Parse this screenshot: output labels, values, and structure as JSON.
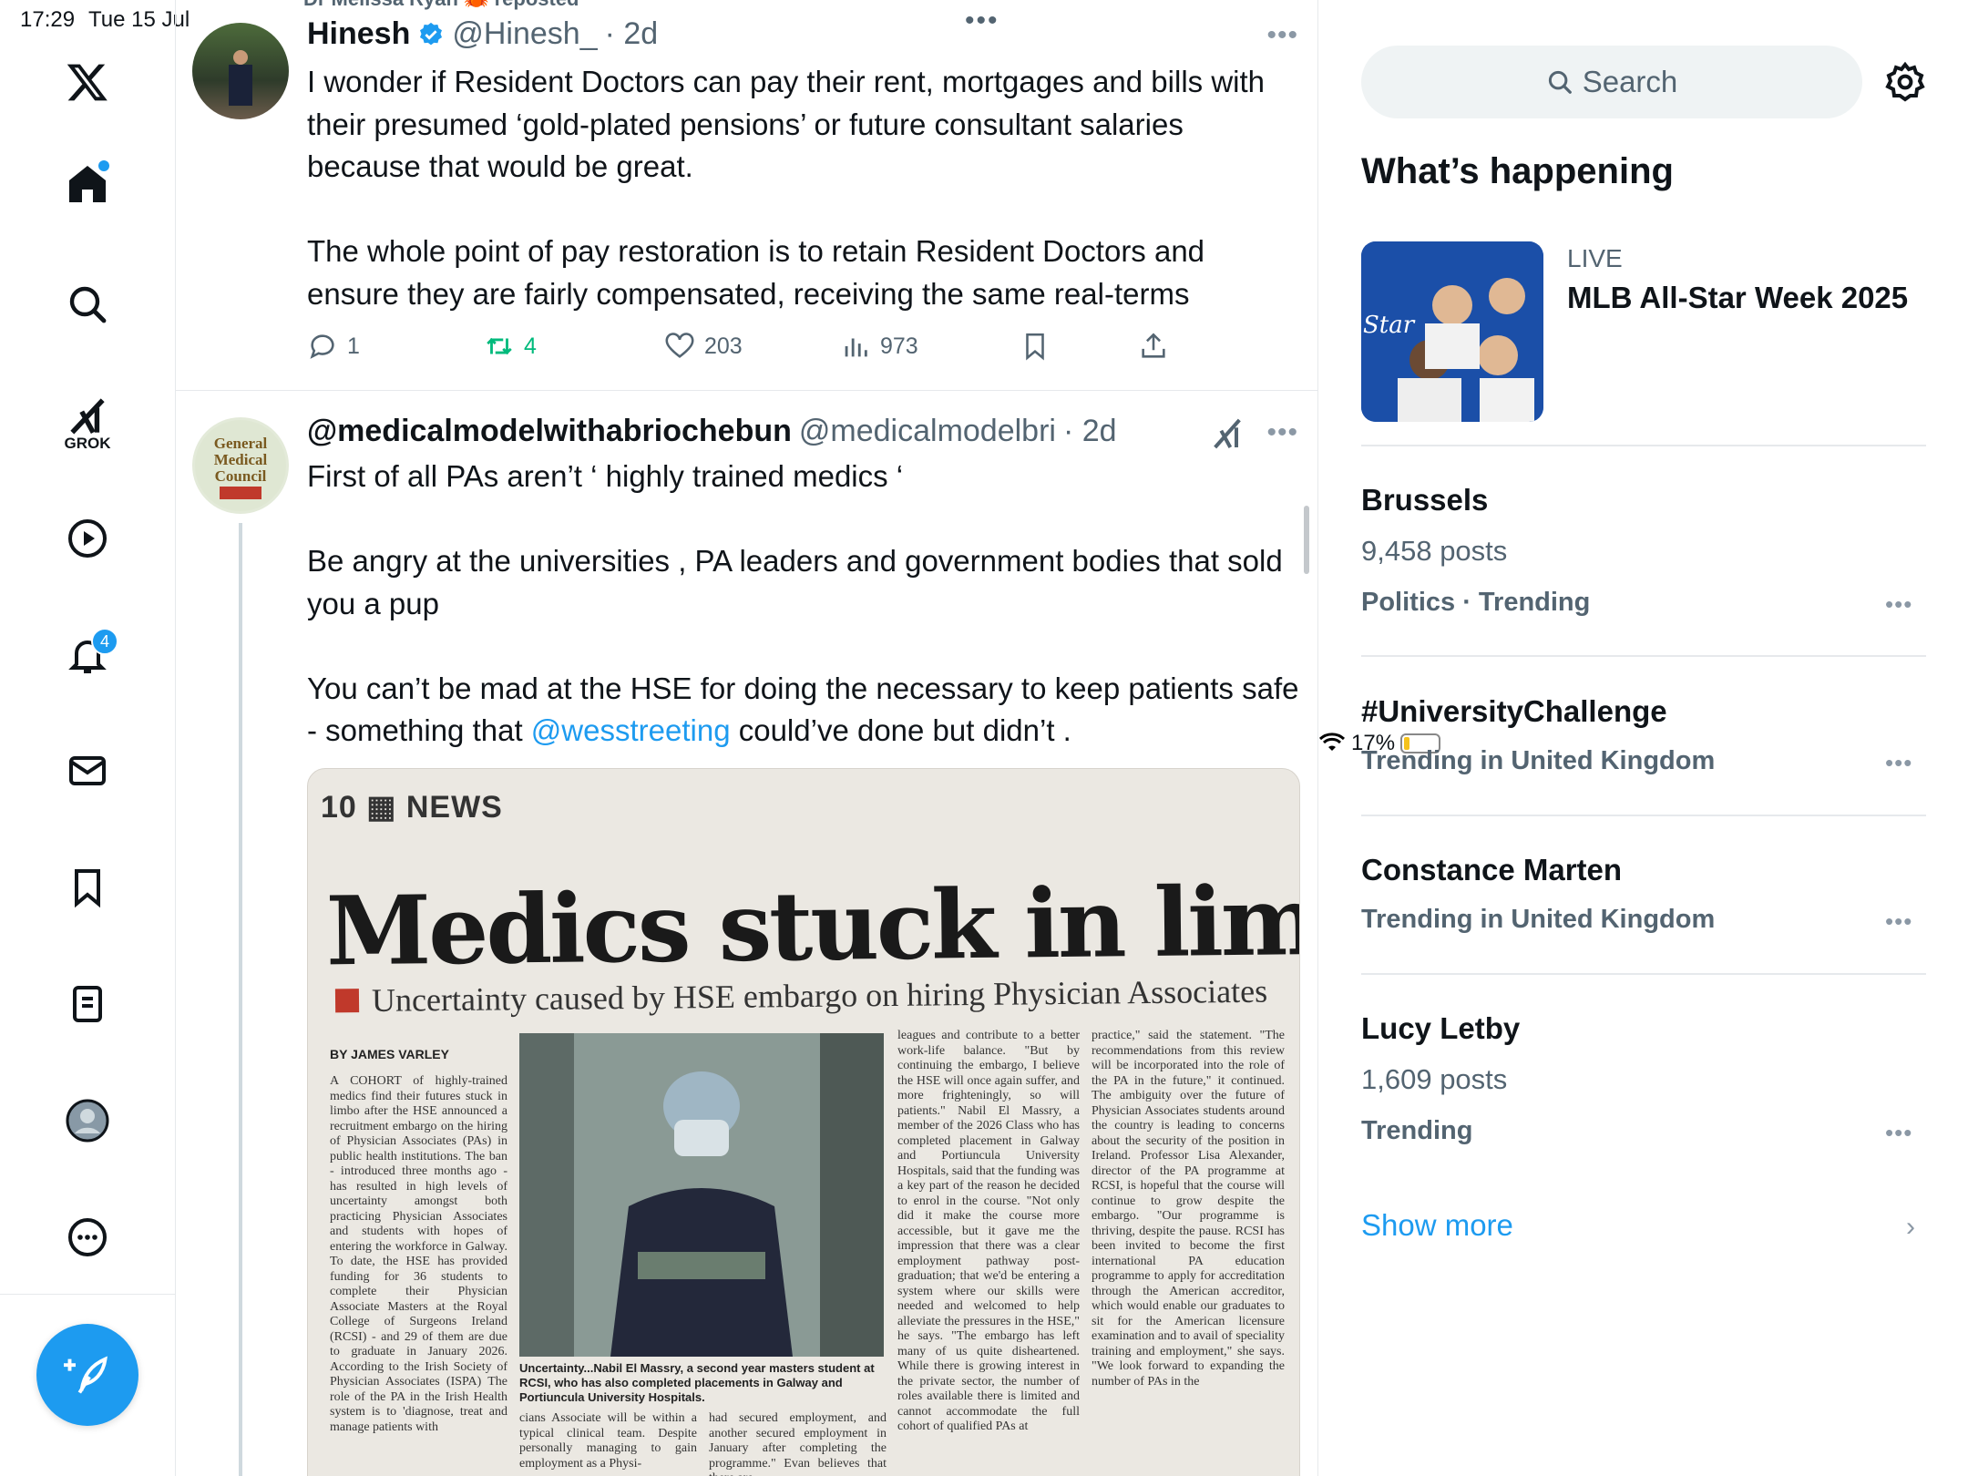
{
  "status_bar": {
    "time": "17:29",
    "date": "Tue 15 Jul",
    "battery": "17%",
    "battery_level": 0.17
  },
  "nav": {
    "logo": "x-logo-icon",
    "items": [
      {
        "name": "home",
        "icon": "home-icon"
      },
      {
        "name": "explore",
        "icon": "search-icon"
      },
      {
        "name": "grok",
        "icon": "grok-icon",
        "label": "GROK"
      },
      {
        "name": "video",
        "icon": "play-icon"
      },
      {
        "name": "notifications",
        "icon": "bell-icon",
        "badge": "4"
      },
      {
        "name": "messages",
        "icon": "mail-icon"
      },
      {
        "name": "bookmarks",
        "icon": "bookmark-icon"
      },
      {
        "name": "lists",
        "icon": "list-icon"
      },
      {
        "name": "profile",
        "icon": "avatar-icon"
      },
      {
        "name": "more",
        "icon": "more-circle-icon"
      }
    ],
    "compose_icon": "compose-icon"
  },
  "feed": {
    "repost_note": "Dr Melissa Ryan 🦀 reposted",
    "tweets": [
      {
        "name": "Hinesh",
        "handle": "@Hinesh_",
        "time": "· 2d",
        "text": "I wonder if Resident Doctors can pay their rent, mortgages and bills with their presumed ‘gold-plated pensions’ or future consultant salaries because that would be great.\n\nThe whole point of pay restoration is to retain Resident Doctors and ensure they are fairly compensated, receiving the same real-terms",
        "replies": "1",
        "reposts": "4",
        "likes": "203",
        "views": "973"
      },
      {
        "name": "@medicalmodelwithabriochebun",
        "handle": "@medicalmodelbri",
        "time": "· 2d",
        "text_before": "First of all PAs aren’t ‘ highly trained medics ‘\n\nBe angry at the universities , PA leaders and government bodies that sold you a pup\n\nYou can’t be mad at the HSE for doing the necessary to keep patients safe - something that ",
        "mention": "@wesstreeting",
        "text_after": " could’ve done but didn’t .",
        "avatar_text": "General Medical Council",
        "newspaper": {
          "kicker": "10 ▦ NEWS",
          "headline": "Medics stuck in limbo",
          "subheadline": "Uncertainty caused by HSE embargo on hiring Physician Associates",
          "byline": "BY JAMES VARLEY",
          "col1": "A COHORT of highly-trained medics find their futures stuck in limbo after the HSE announced a recruitment embargo on the hiring of Physician Associates (PAs) in public health institutions. The ban - introduced three months ago - has resulted in high levels of uncertainty amongst both practicing Physician Associates and students with hopes of entering the workforce in Galway. To date, the HSE has provided funding for 36 students to complete their Physician Associate Masters at the Royal College of Surgeons Ireland (RCSI) - and 29 of them are due to graduate in January 2026. According to the Irish Society of Physician Associates (ISPA) The role of the PA in the Irish Health system is to 'diagnose, treat and manage patients with",
          "col3": "leagues and contribute to a better work-life balance. \"But by continuing the embargo, I believe the HSE will once again suffer, and more frighteningly, so will patients.\" Nabil El Massry, a member of the 2026 Class who has completed placement in Galway and Portiuncula University Hospitals, said that the funding was a key part of the reason he decided to enrol in the course. \"Not only did it make the course more accessible, but it gave me the impression that there was a clear employment pathway post-graduation; that we'd be entering a system where our skills were needed and welcomed to help alleviate the pressures in the HSE,\" he says. \"The embargo has left many of us quite disheartened. While there is growing interest in the private sector, the number of roles available there is limited and cannot accommodate the full cohort of qualified PAs at",
          "col4": "practice,\" said the statement. \"The recommendations from this review will be incorporated into the role of the PA in the future,\" it continued. The ambiguity over the future of Physician Associates students around the country is leading to concerns about the security of the position in Ireland. Professor Lisa Alexander, director of the PA programme at RCSI, is hopeful that the course will continue to grow despite the embargo. \"Our programme is thriving, despite the pause. RCSI has been invited to become the first international PA education programme to apply for accreditation through the American accreditor, which would enable our graduates to sit for the American licensure examination and to avail of speciality training and employment,\" she says. \"We look forward to expanding the number of PAs in the",
          "col2b": "cians Associate will be within a typical clinical team. Despite personally managing to gain employment as a Physi-",
          "col3b": "had secured employment, and another secured employment in January after completing the programme.\" Evan believes that there are",
          "caption": "Uncertainty...Nabil El Massry, a second year masters student at RCSI, who has also completed placements in Galway and Portiuncula University Hospitals."
        }
      }
    ]
  },
  "sidebar": {
    "search_placeholder": "Search",
    "heading": "What’s happening",
    "live": {
      "label": "LIVE",
      "title": "MLB All-Star Week 2025"
    },
    "trends": [
      {
        "title": "Brussels",
        "meta": "9,458 posts",
        "category": "Politics · Trending"
      },
      {
        "title": "#UniversityChallenge",
        "meta": "",
        "category": "Trending in United Kingdom"
      },
      {
        "title": "Constance Marten",
        "meta": "",
        "category": "Trending in United Kingdom"
      },
      {
        "title": "Lucy Letby",
        "meta": "1,609 posts",
        "category": "Trending"
      }
    ],
    "show_more": "Show more"
  },
  "colors": {
    "accent": "#1d9bf0",
    "repost_green": "#00ba7c",
    "muted": "#536471"
  }
}
